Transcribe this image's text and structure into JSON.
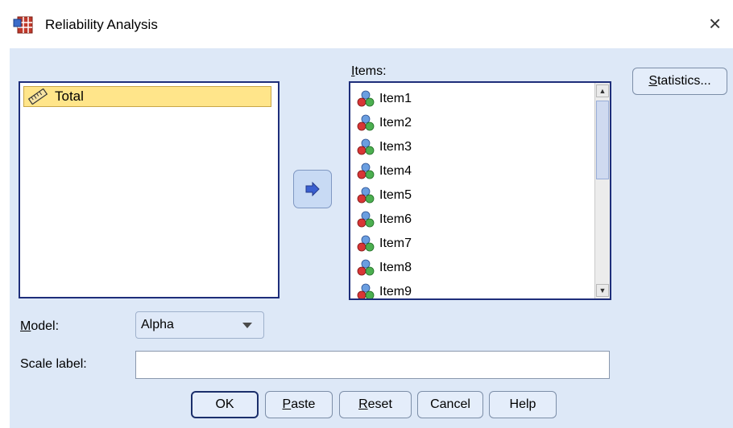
{
  "window": {
    "title": "Reliability Analysis",
    "close_glyph": "×",
    "icon": "spss-table-icon"
  },
  "source_list": {
    "items": [
      {
        "label": "Total",
        "icon": "ruler-scale-icon"
      }
    ]
  },
  "move_button": {
    "icon": "right-arrow-icon"
  },
  "items_list": {
    "label": "Items:",
    "label_mnemonic": "I",
    "label_rest": "tems:",
    "items": [
      "Item1",
      "Item2",
      "Item3",
      "Item4",
      "Item5",
      "Item6",
      "Item7",
      "Item8",
      "Item9"
    ],
    "item_icon": "nominal-variable-icon"
  },
  "statistics_button": {
    "label": "Statistics...",
    "mnemonic": "S",
    "rest": "tatistics..."
  },
  "model": {
    "label": "Model:",
    "mnemonic": "M",
    "rest": "odel:",
    "value": "Alpha"
  },
  "scale_label": {
    "label": "Scale label:",
    "value": ""
  },
  "buttons": {
    "ok": "OK",
    "paste": {
      "label": "Paste",
      "mnemonic": "P",
      "rest": "aste"
    },
    "reset": {
      "label": "Reset",
      "mnemonic": "R",
      "rest": "eset"
    },
    "cancel": "Cancel",
    "help": "Help"
  }
}
